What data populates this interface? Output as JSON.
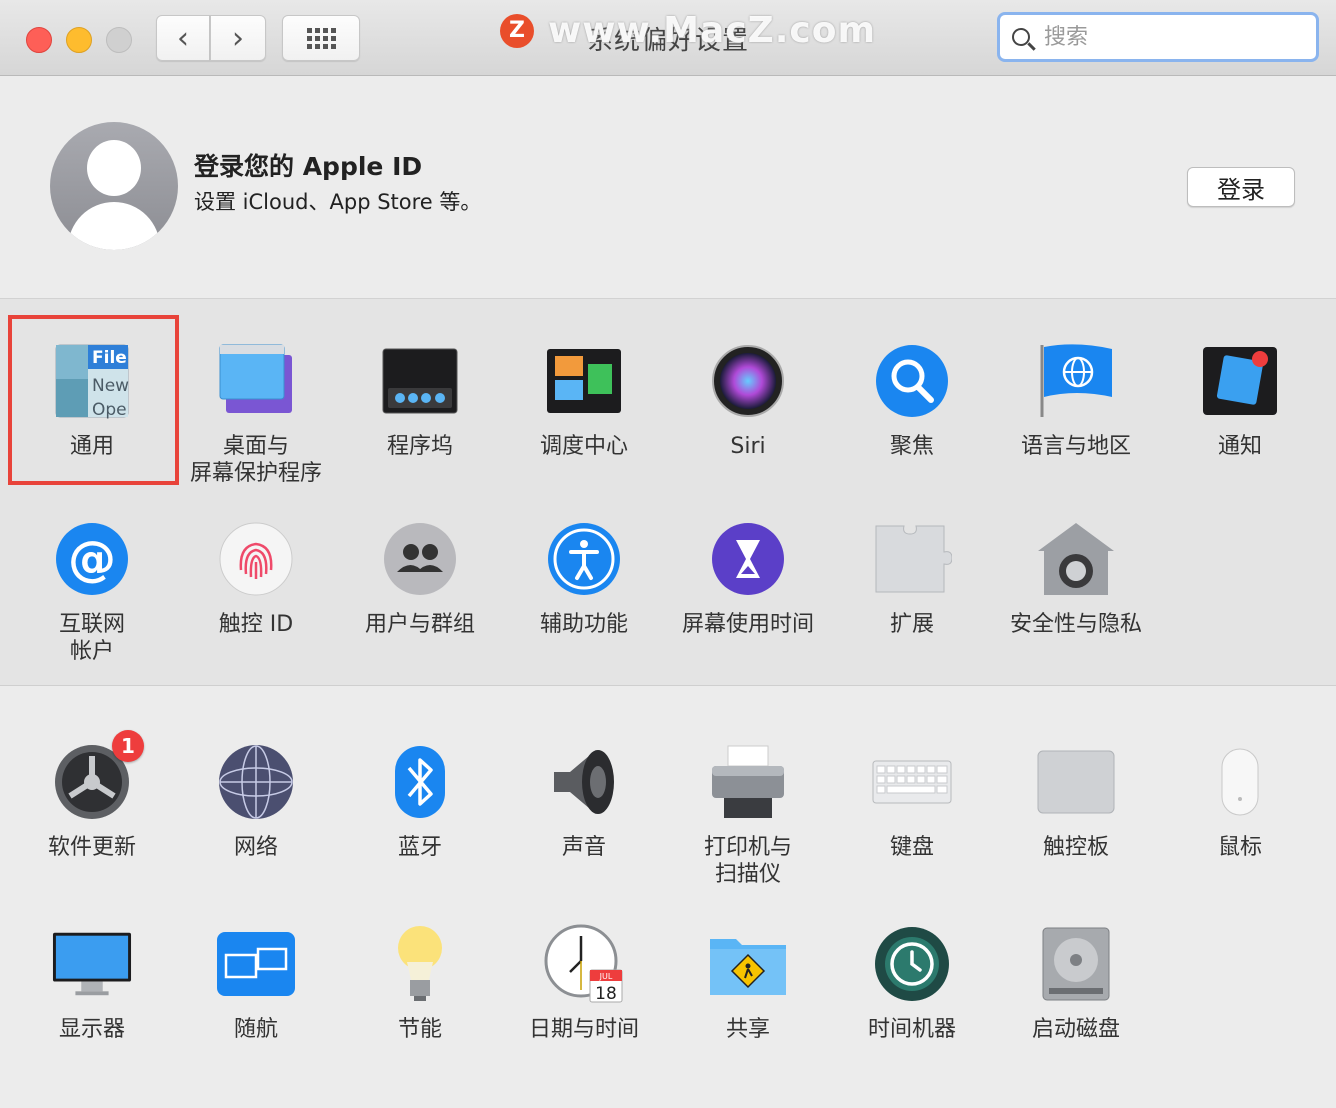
{
  "window": {
    "title": "系统偏好设置"
  },
  "watermark": {
    "text": "www.MacZ.com",
    "logo": "Z"
  },
  "search": {
    "placeholder": "搜索"
  },
  "account": {
    "title": "登录您的 Apple ID",
    "subtitle": "设置 iCloud、App Store 等。",
    "login_label": "登录"
  },
  "row1": [
    {
      "label": "通用",
      "icon": "general-icon"
    },
    {
      "label": "桌面与\n屏幕保护程序",
      "icon": "desktop-screensaver-icon"
    },
    {
      "label": "程序坞",
      "icon": "dock-icon"
    },
    {
      "label": "调度中心",
      "icon": "mission-control-icon"
    },
    {
      "label": "Siri",
      "icon": "siri-icon"
    },
    {
      "label": "聚焦",
      "icon": "spotlight-icon"
    },
    {
      "label": "语言与地区",
      "icon": "language-region-icon"
    },
    {
      "label": "通知",
      "icon": "notifications-icon"
    }
  ],
  "general_icon_text": {
    "line1": "File",
    "line2": "New",
    "line3": "Ope"
  },
  "row2": [
    {
      "label": "互联网\n帐户",
      "icon": "internet-accounts-icon"
    },
    {
      "label": "触控 ID",
      "icon": "touch-id-icon"
    },
    {
      "label": "用户与群组",
      "icon": "users-groups-icon"
    },
    {
      "label": "辅助功能",
      "icon": "accessibility-icon"
    },
    {
      "label": "屏幕使用时间",
      "icon": "screen-time-icon"
    },
    {
      "label": "扩展",
      "icon": "extensions-icon"
    },
    {
      "label": "安全性与隐私",
      "icon": "security-privacy-icon"
    }
  ],
  "row3": [
    {
      "label": "软件更新",
      "icon": "software-update-icon",
      "badge": "1"
    },
    {
      "label": "网络",
      "icon": "network-icon"
    },
    {
      "label": "蓝牙",
      "icon": "bluetooth-icon"
    },
    {
      "label": "声音",
      "icon": "sound-icon"
    },
    {
      "label": "打印机与\n扫描仪",
      "icon": "printers-scanners-icon"
    },
    {
      "label": "键盘",
      "icon": "keyboard-icon"
    },
    {
      "label": "触控板",
      "icon": "trackpad-icon"
    },
    {
      "label": "鼠标",
      "icon": "mouse-icon"
    }
  ],
  "row4": [
    {
      "label": "显示器",
      "icon": "displays-icon"
    },
    {
      "label": "随航",
      "icon": "sidecar-icon"
    },
    {
      "label": "节能",
      "icon": "energy-saver-icon"
    },
    {
      "label": "日期与时间",
      "icon": "date-time-icon"
    },
    {
      "label": "共享",
      "icon": "sharing-icon"
    },
    {
      "label": "时间机器",
      "icon": "time-machine-icon"
    },
    {
      "label": "启动磁盘",
      "icon": "startup-disk-icon"
    }
  ],
  "calendar_icon": {
    "month": "JUL",
    "day": "18"
  },
  "colors": {
    "highlight": "#e8433a",
    "badge": "#ee3d3d",
    "accent": "#1a86f0"
  }
}
